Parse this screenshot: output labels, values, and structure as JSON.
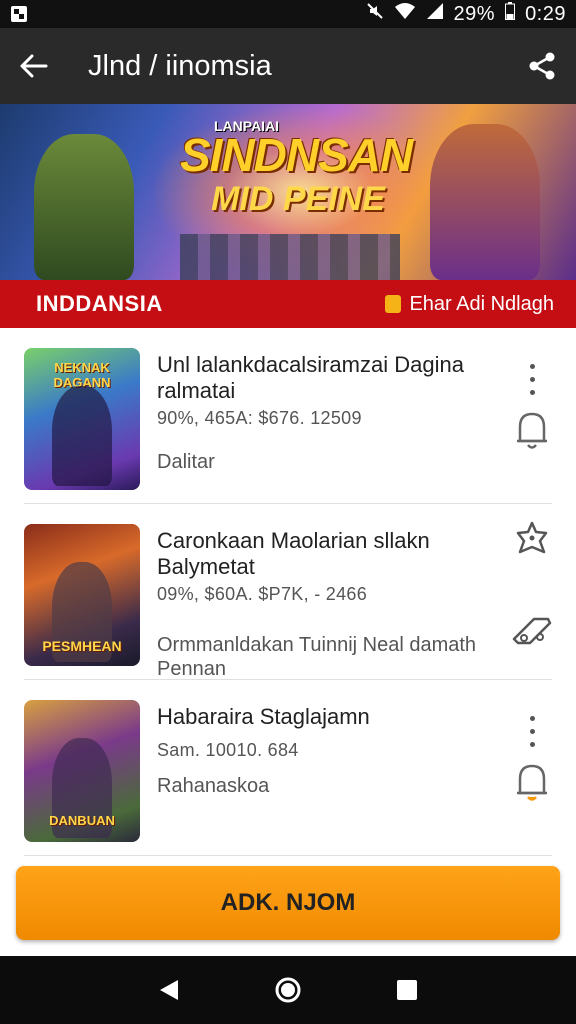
{
  "status_bar": {
    "battery": "29%",
    "time": "0:29",
    "icons": [
      "app-icon",
      "mute-icon",
      "wifi-icon",
      "signal-icon",
      "battery-icon"
    ]
  },
  "app_bar": {
    "title": "Jlnd / iinomsia",
    "icons": [
      "back-arrow-icon",
      "share-icon"
    ]
  },
  "banner": {
    "subtitle": "LANPAIAI",
    "title_line1": "SINDNSAN",
    "title_line2": "MID PEINE"
  },
  "region_bar": {
    "left": "INDDANSIA",
    "right": "Ehar Adi Ndlagh",
    "right_icon": "flag-icon"
  },
  "items": [
    {
      "thumb_text": "NEKNAK DAGANN",
      "name": "Unl lalankdacalsiramzai Dagina ralmatai",
      "meta": "90%, 465A: $676. 12509",
      "desc": "Dalitar",
      "icons": [
        "more-vert-icon",
        "bell-icon"
      ]
    },
    {
      "thumb_text": "PESMHEAN",
      "name": "Caronkaan Maolarian sllakn Balymetat",
      "meta": "09%, $60A. $P7K, - 2466",
      "desc": "Ormmanldakan Tuinnij Neal damath Pennan",
      "icons": [
        "star-badge-icon",
        "tag-icon"
      ]
    },
    {
      "thumb_text": "DANBUAN",
      "name": "Habaraira Staglajamn",
      "meta": "Sam. 10010. 684",
      "desc": "Rahanaskoa",
      "icons": [
        "more-vert-icon",
        "bell-icon"
      ]
    }
  ],
  "cta": {
    "label": "ADK. NJOM"
  },
  "nav_bar": {
    "icons": [
      "back-triangle-icon",
      "home-circle-icon",
      "recents-square-icon"
    ]
  },
  "colors": {
    "app_bar": "#2a2a2a",
    "region_bar": "#c40e14",
    "cta": "#f99a0c",
    "nav_bar": "#0c0c0c"
  }
}
